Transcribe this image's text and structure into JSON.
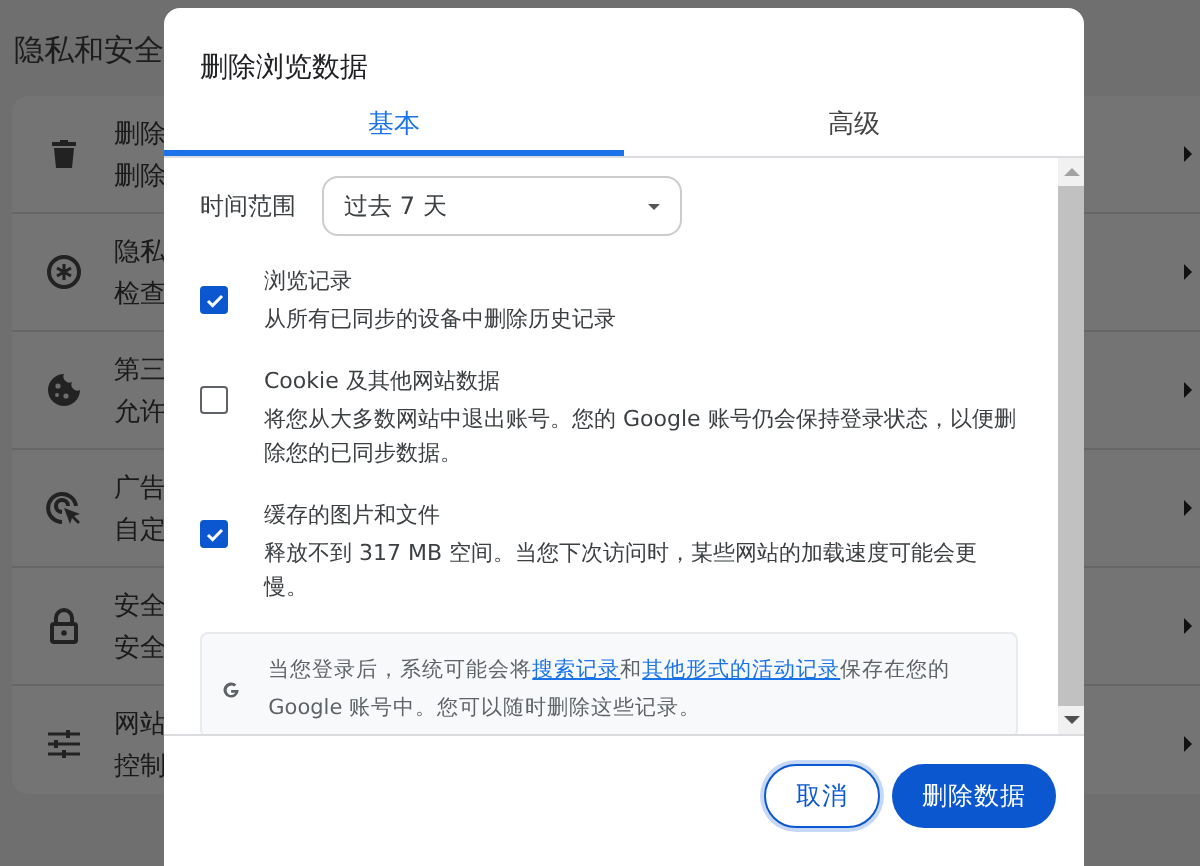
{
  "page": {
    "title": "隐私和安全",
    "rows": [
      {
        "title": "删除",
        "subtitle": "删除"
      },
      {
        "title": "隐私",
        "subtitle": "检查"
      },
      {
        "title": "第三",
        "subtitle": "允许"
      },
      {
        "title": "广告",
        "subtitle": "自定"
      },
      {
        "title": "安全",
        "subtitle": "安全"
      },
      {
        "title": "网站",
        "subtitle": "控制"
      }
    ]
  },
  "dialog": {
    "title": "删除浏览数据",
    "tabs": [
      {
        "label": "基本",
        "selected": true
      },
      {
        "label": "高级",
        "selected": false
      }
    ],
    "time_range": {
      "label": "时间范围",
      "value": "过去 7 天"
    },
    "options": [
      {
        "checked": true,
        "title": "浏览记录",
        "description": "从所有已同步的设备中删除历史记录"
      },
      {
        "checked": false,
        "title": "Cookie 及其他网站数据",
        "description": "将您从大多数网站中退出账号。您的 Google 账号仍会保持登录状态，以便删除您的已同步数据。"
      },
      {
        "checked": true,
        "title": "缓存的图片和文件",
        "description": "释放不到 317 MB 空间。当您下次访问时，某些网站的加载速度可能会更慢。"
      }
    ],
    "info": {
      "text_before": "当您登录后，系统可能会将",
      "link_1": "搜索记录",
      "text_middle": "和",
      "link_2": "其他形式的活动记录",
      "text_after": "保存在您的 Google 账号中。您可以随时删除这些记录。"
    },
    "buttons": [
      {
        "kind": "outlined",
        "label": "取消"
      },
      {
        "kind": "filled",
        "label": "删除数据"
      }
    ]
  }
}
